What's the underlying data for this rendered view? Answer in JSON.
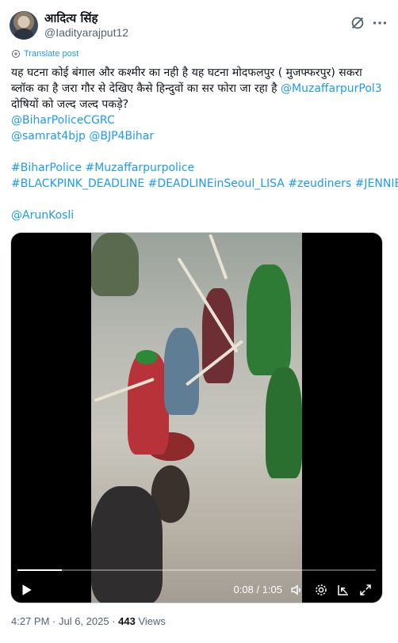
{
  "author": {
    "display_name": "आदित्य सिंह",
    "handle": "@Iadityarajput12"
  },
  "header_actions": {
    "grok_icon": "grok-icon",
    "more_icon": "more-icon"
  },
  "translate_label": "Translate post",
  "tweet": {
    "line1": "यह घटना कोई बंगाल और कश्मीर का नही है यह घटना मोदफलपुर ( मुजफ्फरपुर) सकरा",
    "line2_text": "ब्लॉक का है जरा गौर से देखिए कैसे हिन्दुवों का सर फोरा जा रहा है ",
    "line2_mention": "@MuzaffarpurPol3",
    "line3": "दोषियों को जल्द जल्द पकड़े?",
    "mention_bihar_police": "@BiharPoliceCGRC",
    "mention_samrat": "@samrat4bjp",
    "mention_bjp": "@BJP4Bihar",
    "hashtag_biharpolice": "#BiharPolice",
    "hashtag_muzaffarpurpolice": "#Muzaffarpurpolice",
    "hashtag_blackpink": "#BLACKPINK_DEADLINE",
    "hashtag_deadline_seoul": "#DEADLINEinSeoul_LISA",
    "hashtag_zeudiners": "#zeudiners",
    "hashtag_jennie": "#JENNIE",
    "mention_arun": "@ArunKosli"
  },
  "video": {
    "current_time": "0:08",
    "separator": " / ",
    "duration": "1:05",
    "progress_fraction": 0.123
  },
  "meta": {
    "time": "4:27 PM",
    "dot": " · ",
    "date": "Jul 6, 2025",
    "views_count": "443",
    "views_label": " Views"
  },
  "colors": {
    "link": "#1d9bf0",
    "text": "#0f1419",
    "secondary": "#536471"
  }
}
